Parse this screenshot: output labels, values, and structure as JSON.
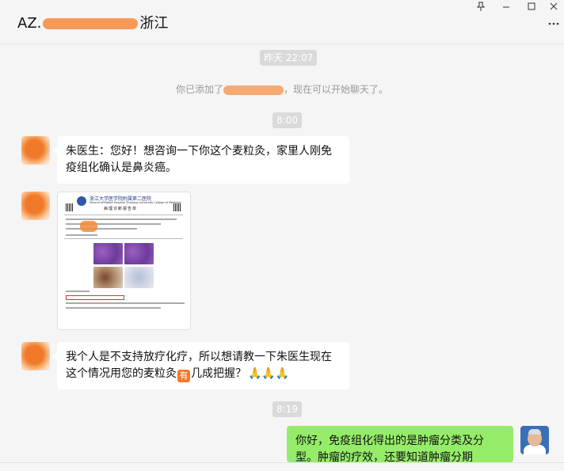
{
  "window": {
    "title_prefix": "AZ.",
    "title_suffix": "浙江",
    "pin_icon": "pin-icon",
    "minimize_icon": "minimize-icon",
    "maximize_icon": "maximize-icon",
    "close_icon": "close-icon",
    "more_icon": "more-icon"
  },
  "chat": {
    "timestamp_1": "昨天 22:07",
    "system_prefix": "你已添加了",
    "system_suffix": "，现在可以开始聊天了。",
    "timestamp_2": "8:00",
    "msg_1": "朱医生：您好！想咨询一下你这个麦粒灸，家里人刚免疫组化确认是鼻炎癌。",
    "image": {
      "hospital_name": "浙江大学医学院附属第二医院",
      "hospital_en": "Second Affiliated Hospital Zhejiang University College of Medicine",
      "report_name": "病理诊断报告单"
    },
    "msg_2_part1": "我个人是不支持放疗化疗，所以想请教一下朱医生现在这个情况用您的麦粒灸",
    "msg_2_emoji": "有",
    "msg_2_part2": "几成把握？",
    "msg_2_hands": "🙏🙏🙏",
    "timestamp_3": "8:19",
    "msg_3": "你好，免疫组化得出的是肿瘤分类及分型。肿瘤的疗效，还要知道肿瘤分期"
  },
  "colors": {
    "self_bubble": "#95ec69",
    "other_bubble": "#ffffff",
    "background": "#f5f5f5",
    "timestamp_bg": "#dadada"
  }
}
